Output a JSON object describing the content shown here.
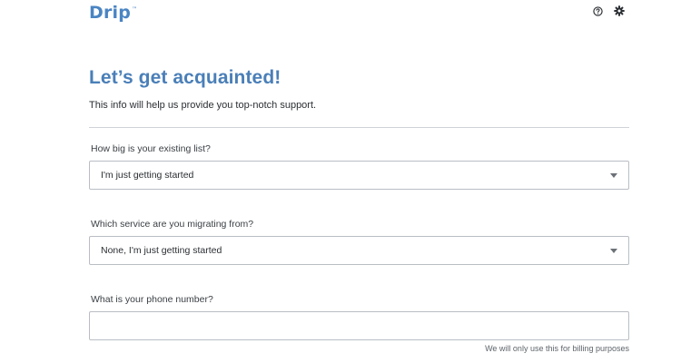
{
  "header": {
    "logo": "Drip",
    "logo_tm": "™",
    "icons": [
      "help-icon",
      "gear-icon"
    ]
  },
  "main": {
    "title": "Let’s get acquainted!",
    "subtitle": "This info will help us provide you top-notch support.",
    "fields": {
      "list_size": {
        "label": "How big is your existing list?",
        "value": "I'm just getting started"
      },
      "migrating_from": {
        "label": "Which service are you migrating from?",
        "value": "None, I'm just getting started"
      },
      "phone": {
        "label": "What is your phone number?",
        "value": "",
        "hint": "We will only use this for billing purposes"
      }
    }
  },
  "colors": {
    "brand_blue": "#4a84c3",
    "title_blue": "#4a7fb8",
    "border": "#b9bec4",
    "divider": "#cfd3d7"
  }
}
